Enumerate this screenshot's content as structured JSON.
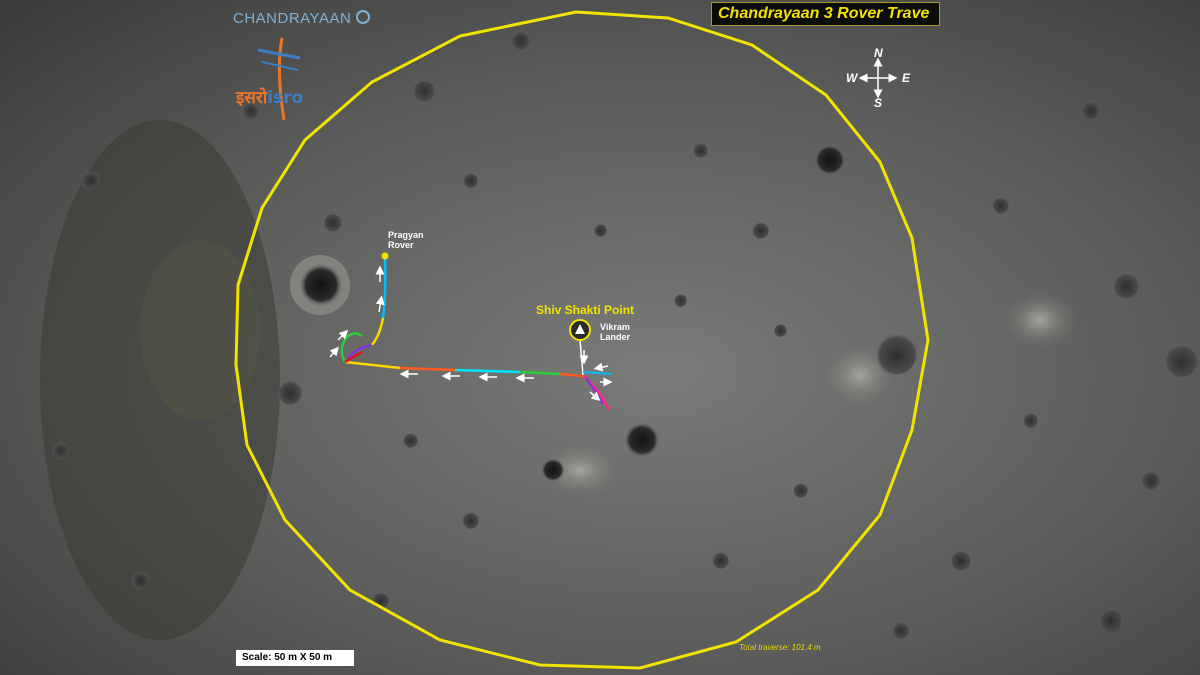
{
  "title": "Chandrayaan 3 Rover Trave",
  "branding": {
    "mission": "CHANDRAYAAN",
    "agency_hindi": "इसरो",
    "agency_english": "isro"
  },
  "compass": {
    "north": "N",
    "south": "S",
    "east": "E",
    "west": "W"
  },
  "labels": {
    "rover": [
      "Pragyan",
      "Rover"
    ],
    "lander": [
      "Vikram",
      "Lander"
    ],
    "landing_site": "Shiv Shakti Point"
  },
  "scale": "Scale: 50 m X 50 m",
  "total_traverse": "Total traverse: 101.4 m",
  "colors": {
    "boundary": "#f2e300",
    "path_segments": [
      "#ff2a8a",
      "#8a2be2",
      "#00bfff",
      "#ff5a1f",
      "#2ecc40",
      "#ffd700",
      "#00e5ff"
    ]
  }
}
